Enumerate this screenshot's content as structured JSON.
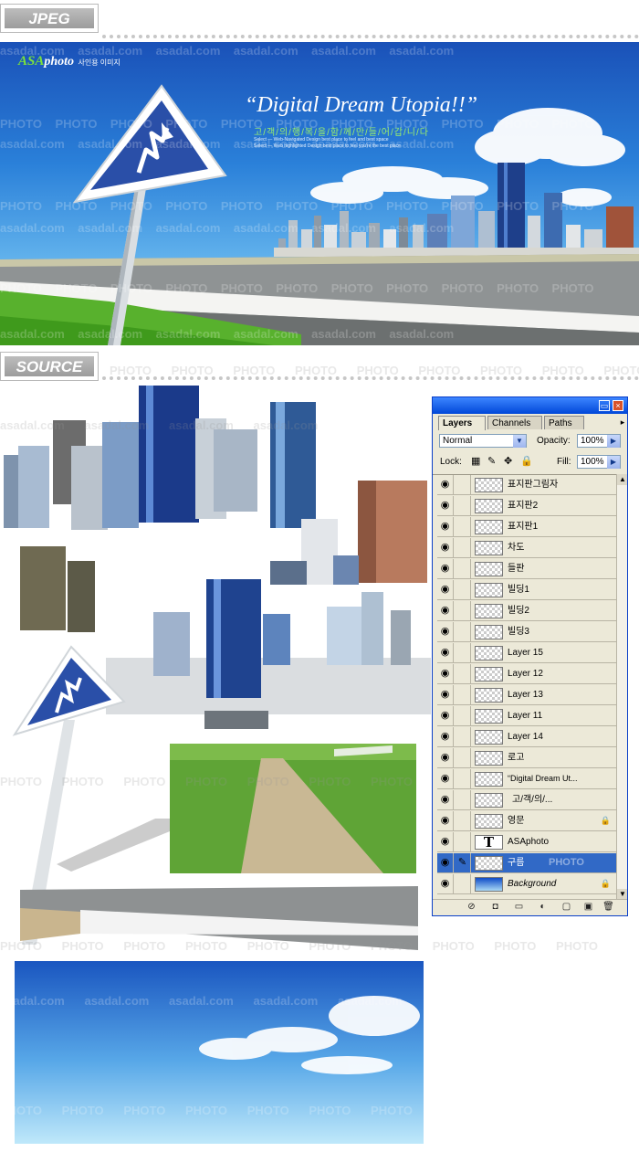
{
  "sections": {
    "jpeg_label": "JPEG",
    "source_label": "SOURCE"
  },
  "banner": {
    "logo_brand": "ASA",
    "logo_word": "photo",
    "logo_sub": "사인용 이미지",
    "headline": "“Digital Dream Utopia!!”",
    "korean_line": "고/객/의/행/복/을/함/께/만/들/어/갑/니/다",
    "small_text_1": "Select — Web-Navigated Design best place to feel and best space",
    "small_text_2": "Select — Web highlighted Design best place to feel you're the best place"
  },
  "watermarks": {
    "photo": "PHOTO",
    "asadal": "asadal.com"
  },
  "layers_panel": {
    "tabs": [
      "Layers",
      "Channels",
      "Paths"
    ],
    "blend_mode": "Normal",
    "opacity_label": "Opacity:",
    "opacity_value": "100%",
    "lock_label": "Lock:",
    "fill_label": "Fill:",
    "fill_value": "100%",
    "layers": [
      {
        "name": "표지판그림자"
      },
      {
        "name": "표지판2"
      },
      {
        "name": "표지판1"
      },
      {
        "name": "차도"
      },
      {
        "name": "들판"
      },
      {
        "name": "빌딩1"
      },
      {
        "name": "빌딩2"
      },
      {
        "name": "빌딩3"
      },
      {
        "name": "Layer 15"
      },
      {
        "name": "Layer 12"
      },
      {
        "name": "Layer 13"
      },
      {
        "name": "Layer 11"
      },
      {
        "name": "Layer 14"
      },
      {
        "name": "로고"
      },
      {
        "name": "“Digital Dream Ut..."
      },
      {
        "name": "고/객/의/..."
      },
      {
        "name": "영문"
      },
      {
        "name": "ASAphoto"
      },
      {
        "name": "구름"
      },
      {
        "name": "Background"
      }
    ],
    "selected_layer_watermark": "PHOTO",
    "text_thumb_glyph": "T"
  },
  "colors": {
    "sky_top": "#1a51b8",
    "sky_bottom": "#d9f1fa",
    "sign_blue": "#2a4fa8",
    "selection_blue": "#3169c6",
    "panel_bg": "#ece9d8",
    "title_bar": "#0047d8"
  }
}
